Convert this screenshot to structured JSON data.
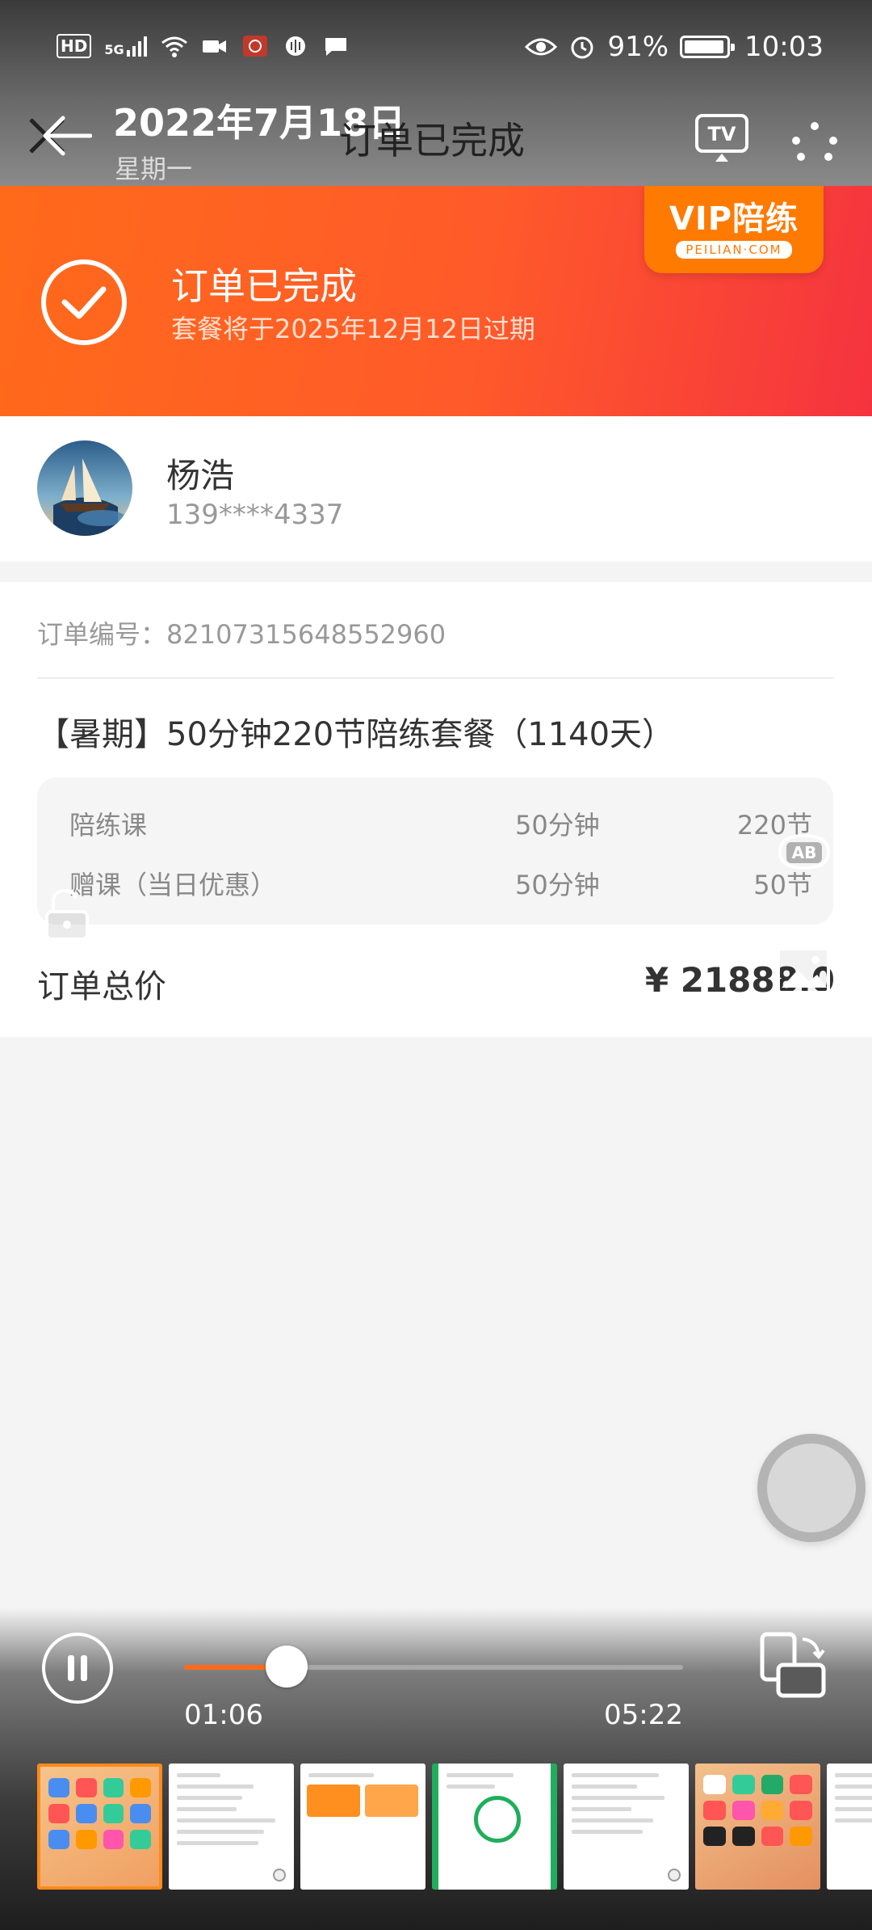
{
  "status_bar": {
    "hd": "HD",
    "network": "5G",
    "battery_percent": "91%",
    "time": "10:03"
  },
  "nav": {
    "date": "2022年7月18日",
    "weekday": "星期一",
    "title": "订单已完成",
    "tv_label": "TV"
  },
  "banner": {
    "brand_main": "VIP陪练",
    "brand_sub": "PEILIAN·COM",
    "status_title": "订单已完成",
    "status_sub": "套餐将于2025年12月12日过期"
  },
  "user": {
    "name": "杨浩",
    "phone": "139****4337"
  },
  "order": {
    "order_no": "订单编号：82107315648552960",
    "package_title": "【暑期】50分钟220节陪练套餐（1140天）",
    "details": [
      {
        "name": "陪练课",
        "duration": "50分钟",
        "count": "220节"
      },
      {
        "name": "赠课（当日优惠）",
        "duration": "50分钟",
        "count": "50节"
      }
    ],
    "total_label": "订单总价",
    "total_value": "¥ 21888.0"
  },
  "overlay": {
    "ab_label": "AB"
  },
  "player": {
    "current_time": "01:06",
    "total_time": "05:22",
    "progress": 0.205
  },
  "colors": {
    "brand_orange": "#ff6a1a",
    "brand_red": "#f5333f"
  }
}
